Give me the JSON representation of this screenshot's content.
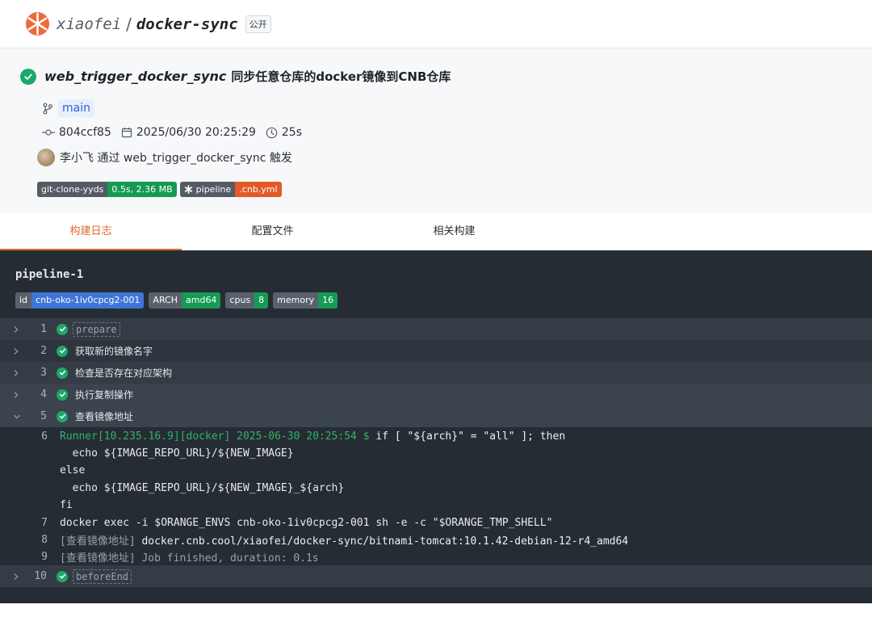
{
  "repo": {
    "owner": "xiaofei",
    "separator": "/",
    "name": "docker-sync",
    "visibility": "公开"
  },
  "build": {
    "pipeline_name": "web_trigger_docker_sync",
    "description": "同步任意仓库的docker镜像到CNB仓库",
    "branch": "main",
    "commit": "804ccf85",
    "datetime": "2025/06/30 20:25:29",
    "duration": "25s",
    "trigger_text": "李小飞 通过 web_trigger_docker_sync 触发",
    "badges": [
      {
        "key": "git-clone-yyds",
        "value": "0.5s, 2.36 MB",
        "color": "#159a52"
      },
      {
        "key": "pipeline",
        "value": ".cnb.yml",
        "color": "#e25a28"
      }
    ]
  },
  "tabs": [
    {
      "label": "构建日志",
      "active": true
    },
    {
      "label": "配置文件",
      "active": false
    },
    {
      "label": "相关构建",
      "active": false
    }
  ],
  "log": {
    "title": "pipeline-1",
    "env": [
      {
        "key": "id",
        "value": "cnb-oko-1iv0cpcg2-001"
      },
      {
        "key": "ARCH",
        "value": "amd64"
      },
      {
        "key": "cpus",
        "value": "8"
      },
      {
        "key": "memory",
        "value": "16"
      }
    ],
    "steps": [
      {
        "num": "1",
        "name": "prepare"
      },
      {
        "num": "2",
        "name": "获取新的镜像名字"
      },
      {
        "num": "3",
        "name": "检查是否存在对应架构"
      },
      {
        "num": "4",
        "name": "执行复制操作"
      },
      {
        "num": "5",
        "name": "查看镜像地址"
      },
      {
        "num": "10",
        "name": "beforeEnd"
      }
    ],
    "lines": [
      {
        "num": "6",
        "prefix": "Runner[10.235.16.9][docker] 2025-06-30 20:25:54 $ ",
        "text": "if [ \"${arch}\" = \"all\" ]; then"
      },
      {
        "num": "",
        "text": "  echo ${IMAGE_REPO_URL}/${NEW_IMAGE}"
      },
      {
        "num": "",
        "text": "else"
      },
      {
        "num": "",
        "text": "  echo ${IMAGE_REPO_URL}/${NEW_IMAGE}_${arch}"
      },
      {
        "num": "",
        "text": "fi"
      },
      {
        "num": "7",
        "text": "docker exec -i $ORANGE_ENVS cnb-oko-1iv0cpcg2-001 sh -e -c \"$ORANGE_TMP_SHELL\""
      },
      {
        "num": "8",
        "prefix": "[查看镜像地址] ",
        "text": "docker.cnb.cool/xiaofei/docker-sync/bitnami-tomcat:10.1.42-debian-12-r4_amd64"
      },
      {
        "num": "9",
        "prefix": "[查看镜像地址] ",
        "text": "Job finished, duration: 0.1s"
      }
    ]
  }
}
